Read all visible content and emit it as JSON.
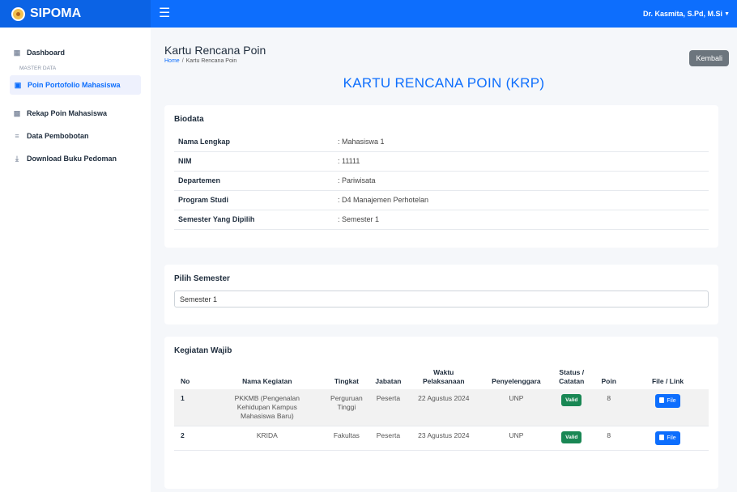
{
  "app": {
    "name": "SIPOMA"
  },
  "topbar": {
    "user_name": "Dr. Kasmita, S.Pd, M.Si"
  },
  "sidebar": {
    "items": [
      {
        "label": "Dashboard"
      },
      {
        "label": "Poin Portofolio Mahasiswa"
      },
      {
        "label": "Rekap Poin Mahasiswa"
      },
      {
        "label": "Data Pembobotan"
      },
      {
        "label": "Download Buku Pedoman"
      }
    ],
    "section_label": "MASTER DATA"
  },
  "header": {
    "title": "Kartu Rencana Poin",
    "breadcrumb": {
      "home": "Home",
      "separator": "/",
      "current": "Kartu Rencana Poin"
    },
    "back_label": "Kembali",
    "main_title": "KARTU RENCANA POIN (KRP)"
  },
  "biodata": {
    "title": "Biodata",
    "rows": [
      {
        "key": "Nama Lengkap",
        "value": ": Mahasiswa 1"
      },
      {
        "key": "NIM",
        "value": ": 11111"
      },
      {
        "key": "Departemen",
        "value": ": Pariwisata"
      },
      {
        "key": "Program Studi",
        "value": ": D4 Manajemen Perhotelan"
      },
      {
        "key": "Semester Yang Dipilih",
        "value": ": Semester 1"
      }
    ]
  },
  "semester": {
    "title": "Pilih Semester",
    "selected": "Semester 1"
  },
  "kegiatan": {
    "title": "Kegiatan Wajib",
    "headers": {
      "no": "No",
      "nama": "Nama Kegiatan",
      "tingkat": "Tingkat",
      "jabatan": "Jabatan",
      "waktu_1": "Waktu",
      "waktu_2": "Pelaksanaan",
      "penyelenggara": "Penyelenggara",
      "status_1": "Status /",
      "status_2": "Catatan",
      "poin": "Poin",
      "file": "File / Link"
    },
    "rows": [
      {
        "no": "1",
        "nama_1": "PKKMB (Pengenalan",
        "nama_2": "Kehidupan Kampus",
        "nama_3": "Mahasiswa Baru)",
        "tingkat_1": "Perguruan",
        "tingkat_2": "Tinggi",
        "jabatan": "Peserta",
        "waktu": "22 Agustus 2024",
        "penyelenggara": "UNP",
        "status": "Valid",
        "poin": "8",
        "file": "File"
      },
      {
        "no": "2",
        "nama_1": "KRIDA",
        "tingkat_1": "Fakultas",
        "jabatan": "Peserta",
        "waktu": "23 Agustus 2024",
        "penyelenggara": "UNP",
        "status": "Valid",
        "poin": "8",
        "file": "File"
      }
    ]
  },
  "colors": {
    "primary": "#0d6efd",
    "valid": "#198754",
    "secondary": "#6c757d"
  },
  "icons": [
    "grid-icon",
    "clipboard-icon",
    "calculator-icon",
    "list-icon",
    "download-icon",
    "hamburger-icon",
    "file-icon"
  ]
}
